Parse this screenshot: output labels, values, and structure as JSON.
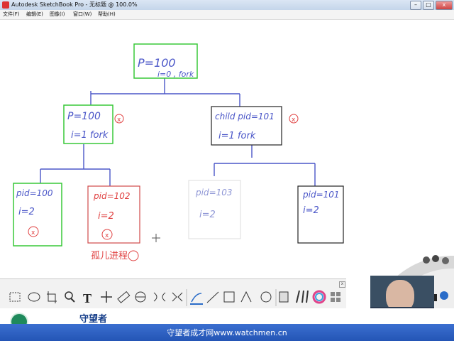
{
  "window": {
    "title": "Autodesk SketchBook Pro - 无标题 @ 100.0%",
    "buttons": {
      "minimize": "–",
      "maximize": "□",
      "close": "x"
    }
  },
  "menu": {
    "items": [
      "文件(F)",
      "编辑(E)",
      "图像(I)",
      "窗口(W)",
      "帮助(H)"
    ]
  },
  "sketch": {
    "root": {
      "line1": "P=100",
      "line2": "i=0 , fork",
      "color": "#38c838"
    },
    "parent": {
      "line1": "P=100",
      "line2": "i=1  fork",
      "color": "#38c838"
    },
    "child": {
      "line1": "child pid=101",
      "line2": "i=1   fork",
      "color": "#222222"
    },
    "leaf1": {
      "line1": "pid=100",
      "line2": "i=2",
      "color": "#38c838"
    },
    "leaf2": {
      "line1": "pid=102",
      "line2": "i=2",
      "note": "孤儿进程",
      "color": "#d04a4a"
    },
    "leaf3": {
      "line1": "pid=103",
      "line2": "i=2",
      "color": "#dddddd"
    },
    "leaf4": {
      "line1": "pid=101",
      "line2": "i=2",
      "color": "#222222"
    },
    "ink_blue": "#4a56c8",
    "ink_red": "#e04040"
  },
  "toolbar": {
    "tools": [
      "select-rect",
      "lasso",
      "crop",
      "zoom",
      "text",
      "move",
      "ruler",
      "ellipse-guide",
      "symmetry-x",
      "symmetry-y",
      "pencil",
      "line",
      "rectangle",
      "polyline",
      "ellipse",
      "stamp",
      "brushes",
      "color-wheel",
      "layers"
    ],
    "close": "x"
  },
  "branding": {
    "name": "守望者",
    "footer": "守望者成才网www.watchmen.cn"
  }
}
